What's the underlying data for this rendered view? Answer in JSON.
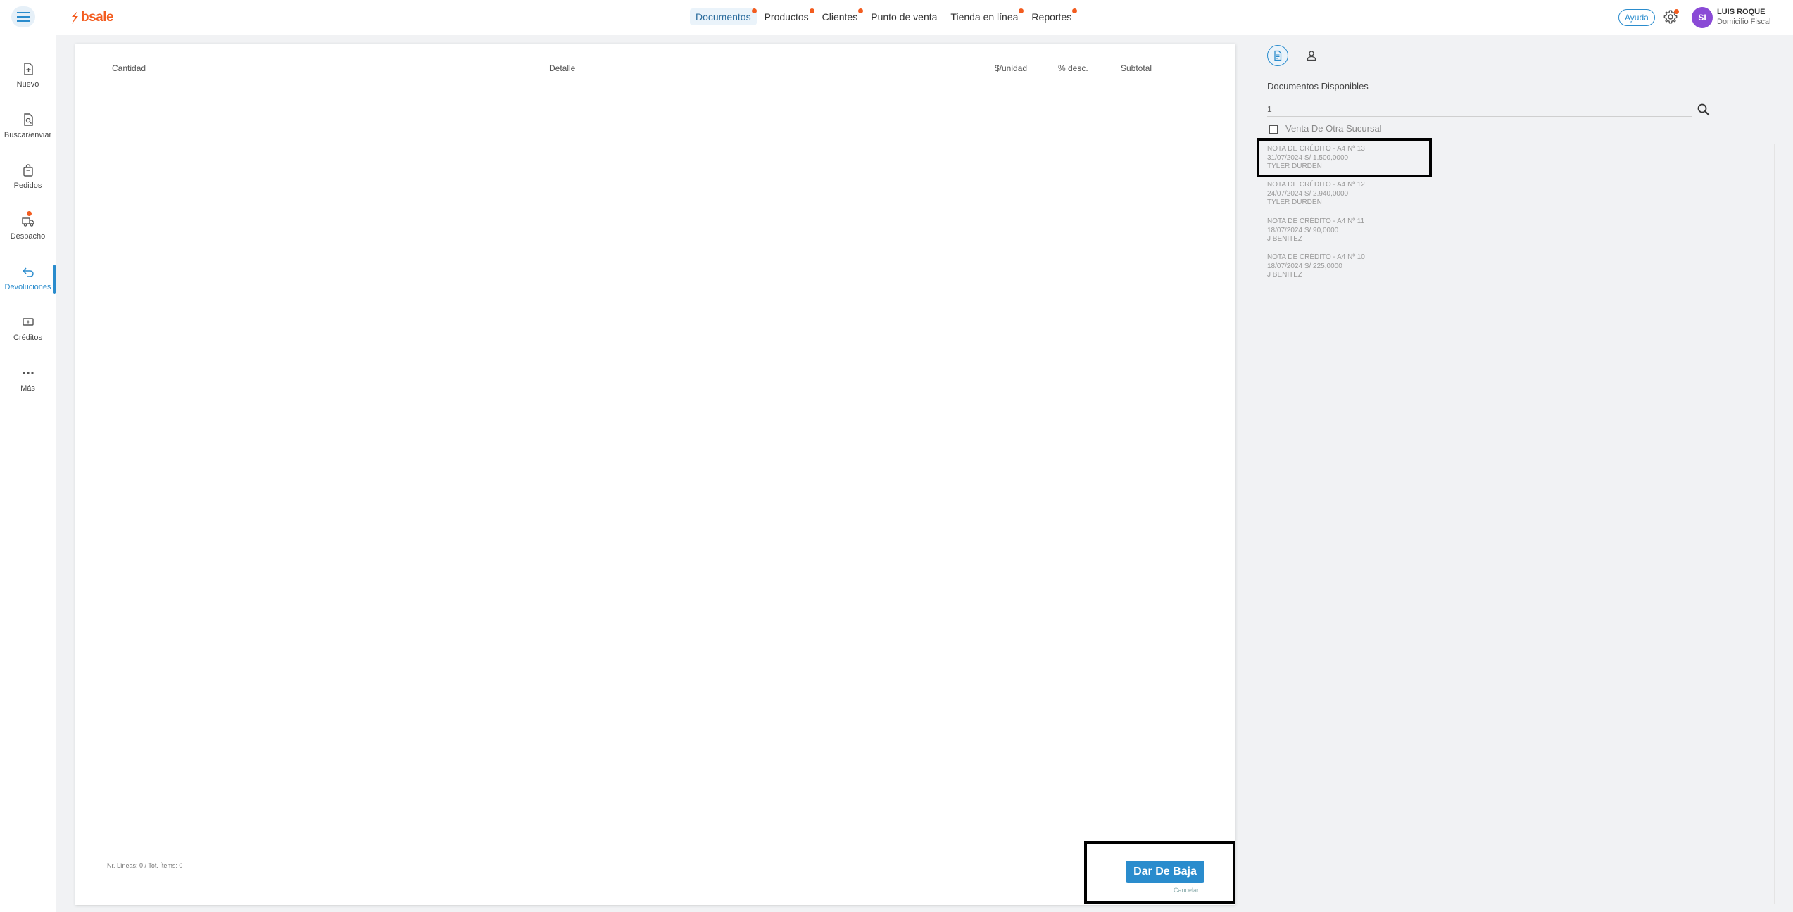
{
  "brand": {
    "name": "bsale",
    "color": "#f35c1f"
  },
  "nav": {
    "items": [
      {
        "label": "Documentos",
        "active": true,
        "dot": true
      },
      {
        "label": "Productos",
        "active": false,
        "dot": true
      },
      {
        "label": "Clientes",
        "active": false,
        "dot": true
      },
      {
        "label": "Punto de venta",
        "active": false,
        "dot": false
      },
      {
        "label": "Tienda en línea",
        "active": false,
        "dot": true
      },
      {
        "label": "Reportes",
        "active": false,
        "dot": true
      }
    ]
  },
  "header": {
    "help_label": "Ayuda",
    "avatar_initials": "SI",
    "user_name": "LUIS ROQUE",
    "user_subtitle": "Domicilio Fiscal"
  },
  "sidebar": {
    "items": [
      {
        "label": "Nuevo",
        "icon": "file-plus-icon"
      },
      {
        "label": "Buscar/enviar",
        "icon": "file-search-icon"
      },
      {
        "label": "Pedidos",
        "icon": "bag-icon"
      },
      {
        "label": "Despacho",
        "icon": "truck-icon"
      },
      {
        "label": "Devoluciones",
        "icon": "return-arrow-icon",
        "active": true
      },
      {
        "label": "Créditos",
        "icon": "credit-icon"
      },
      {
        "label": "Más",
        "icon": "more-dots-icon"
      }
    ]
  },
  "document": {
    "columns": [
      "Cantidad",
      "Detalle",
      "$/unidad",
      "% desc.",
      "Subtotal"
    ],
    "footer_counts": "Nr. Líneas: 0 / Tot. Ítems: 0",
    "primary_action": "Dar De Baja",
    "cancel_label": "Cancelar"
  },
  "right_panel": {
    "title": "Documentos Disponibles",
    "search_value": "1",
    "checkbox_label": "Venta De Otra Sucursal",
    "documents": [
      {
        "title": "NOTA DE CRÉDITO - A4 Nº 13",
        "meta": "31/07/2024 S/ 1.500,0000",
        "client": "TYLER DURDEN"
      },
      {
        "title": "NOTA DE CRÉDITO - A4 Nº 12",
        "meta": "24/07/2024 S/ 2.940,0000",
        "client": "TYLER DURDEN"
      },
      {
        "title": "NOTA DE CRÉDITO - A4 Nº 11",
        "meta": "18/07/2024 S/ 90,0000",
        "client": "J BENITEZ"
      },
      {
        "title": "NOTA DE CRÉDITO - A4 Nº 10",
        "meta": "18/07/2024 S/ 225,0000",
        "client": "J BENITEZ"
      }
    ]
  },
  "colors": {
    "accent": "#2a8ccd",
    "notification": "#f35c1f",
    "avatar": "#8a4ad6"
  }
}
